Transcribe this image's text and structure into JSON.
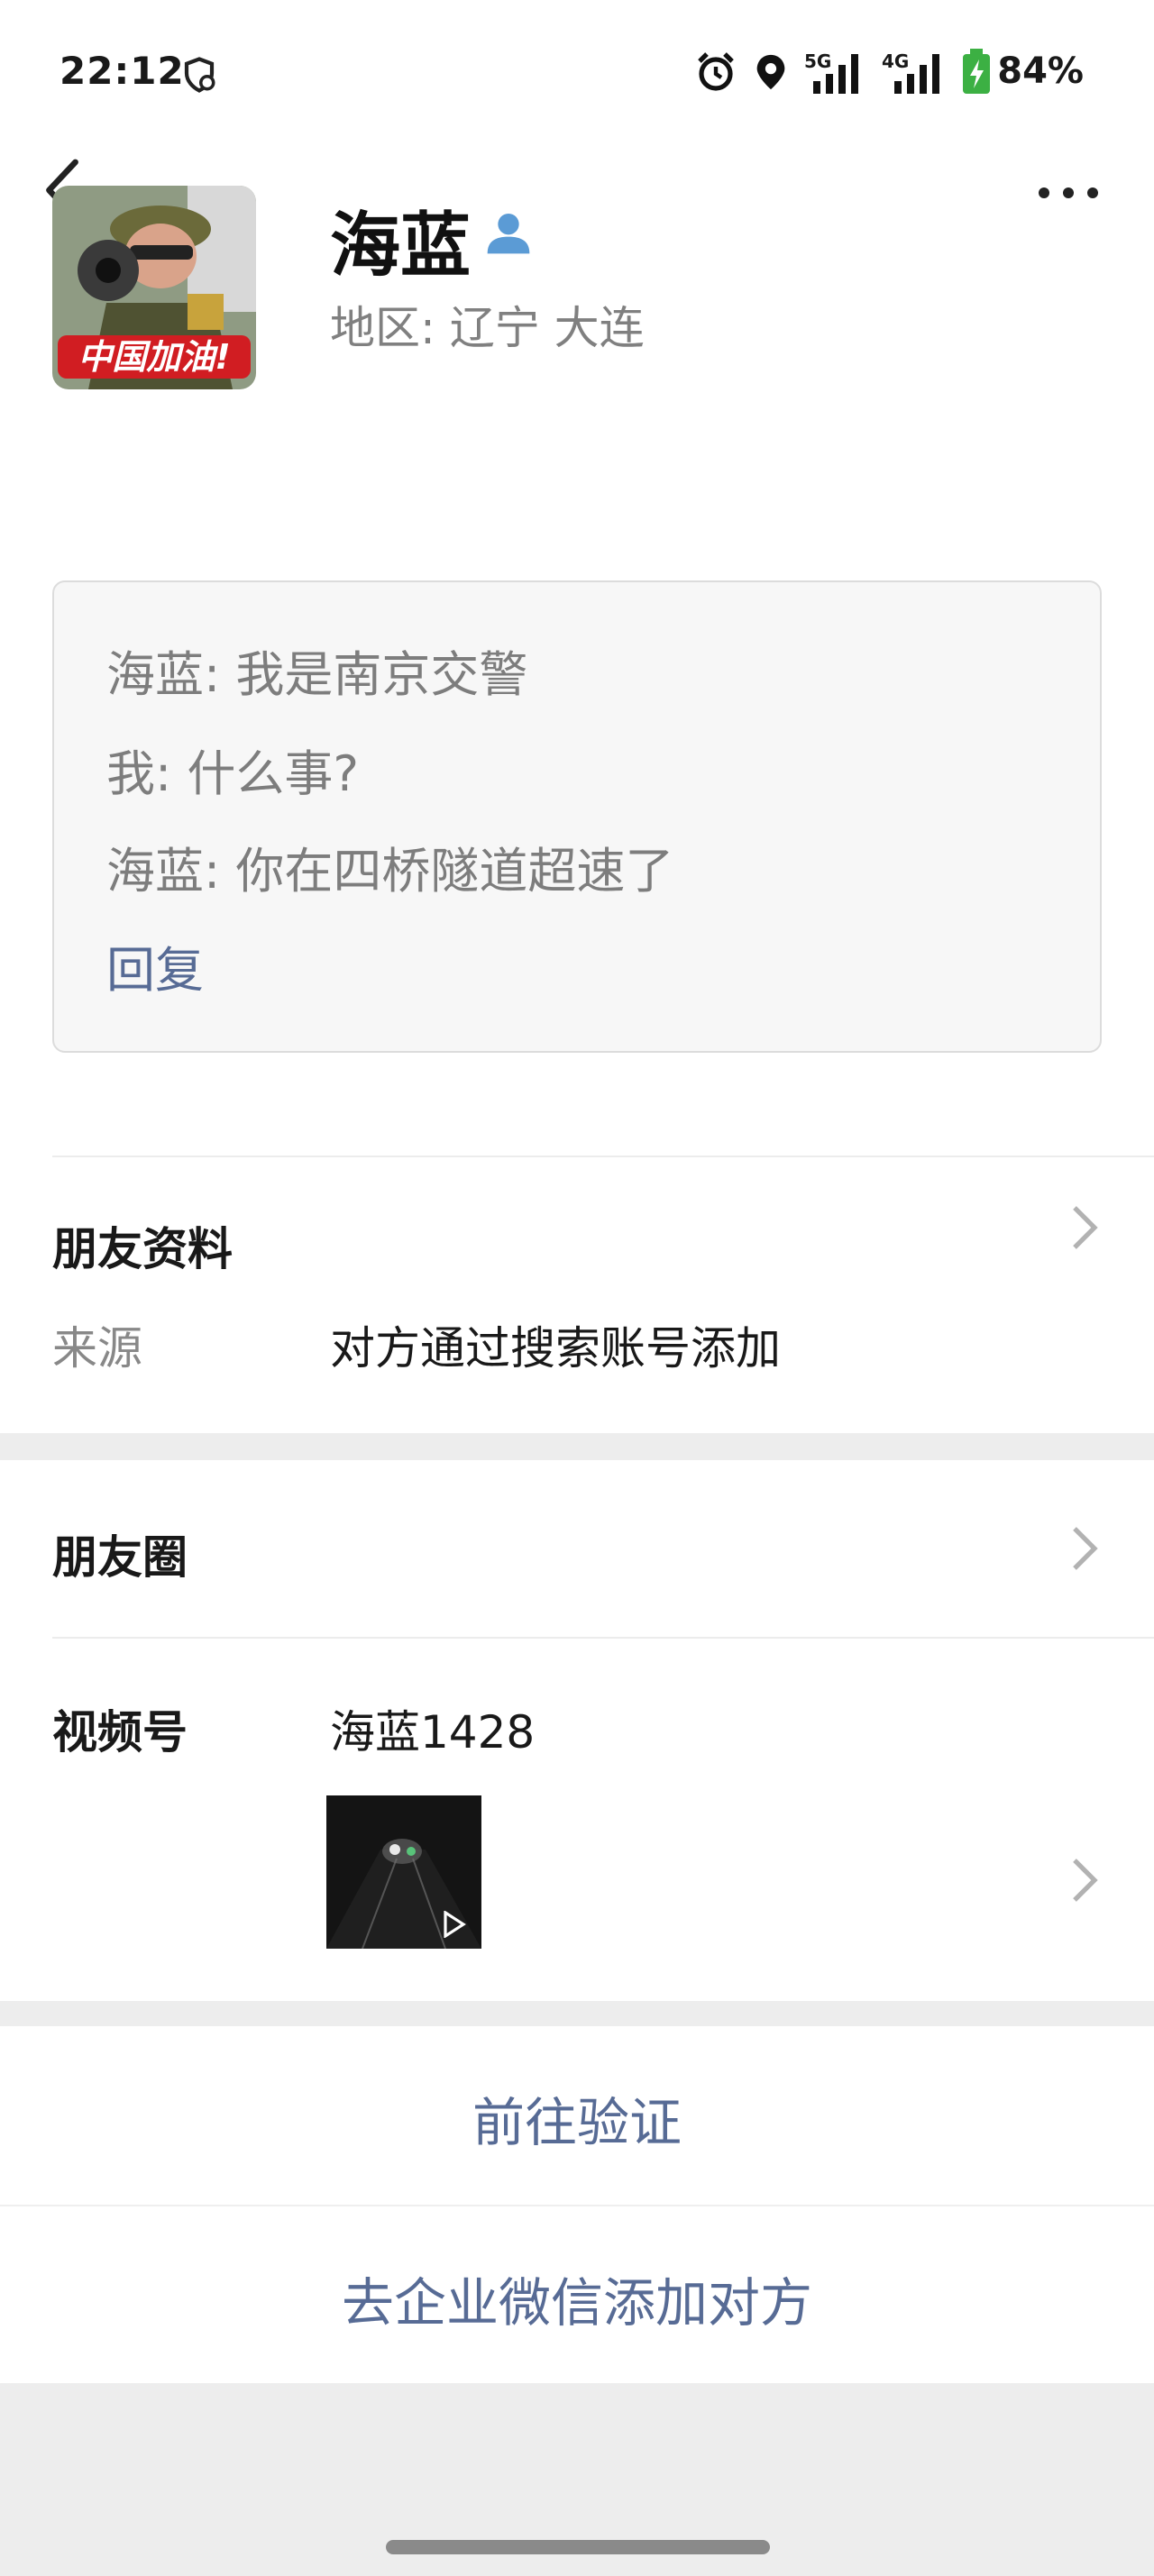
{
  "status_bar": {
    "time": "22:12",
    "signal_1_label": "5G",
    "signal_2_label": "4G",
    "battery": "84%",
    "icons": [
      "shield-icon",
      "alarm-icon",
      "location-icon",
      "signal-5g-icon",
      "signal-4g-icon",
      "battery-charging-icon"
    ]
  },
  "profile": {
    "name": "海蓝",
    "region": "地区:  辽宁  大连",
    "avatar_caption": "中国加油!"
  },
  "messages": {
    "lines": [
      "海蓝: 我是南京交警",
      "我: 什么事?",
      "海蓝: 你在四桥隧道超速了"
    ],
    "reply_label": "回复"
  },
  "friend_info": {
    "title": "朋友资料",
    "source_label": "来源",
    "source_value": "对方通过搜索账号添加"
  },
  "moments": {
    "title": "朋友圈"
  },
  "channels": {
    "title": "视频号",
    "account": "海蓝1428"
  },
  "actions": {
    "verify": "前往验证",
    "wecom": "去企业微信添加对方"
  },
  "colors": {
    "link": "#576b95",
    "background": "#ededed",
    "person_icon": "#5b9bd5"
  }
}
